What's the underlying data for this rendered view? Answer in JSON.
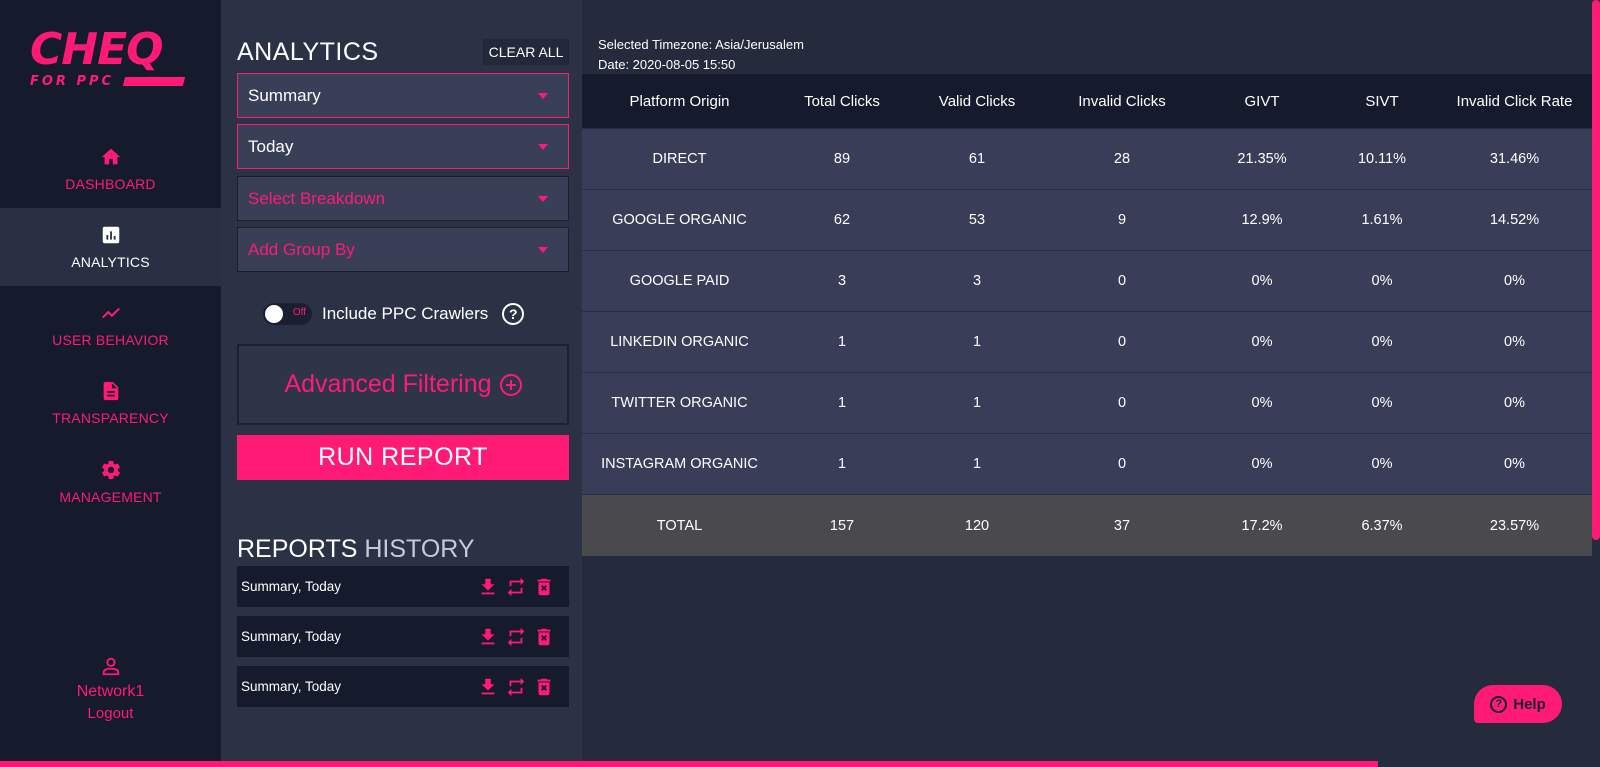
{
  "brand": {
    "logo_main": "CHEQ",
    "logo_sub": "FOR PPC",
    "accent": "#ff1a76"
  },
  "nav": {
    "items": [
      {
        "label": "DASHBOARD",
        "icon": "home-icon"
      },
      {
        "label": "ANALYTICS",
        "icon": "bar-chart-icon"
      },
      {
        "label": "USER BEHAVIOR",
        "icon": "trend-icon"
      },
      {
        "label": "TRANSPARENCY",
        "icon": "document-icon"
      },
      {
        "label": "MANAGEMENT",
        "icon": "gear-icon"
      }
    ],
    "active": "ANALYTICS",
    "user": {
      "name": "Network1",
      "logout": "Logout",
      "icon": "user-icon"
    }
  },
  "panel": {
    "title": "ANALYTICS",
    "clear_all": "CLEAR ALL",
    "report_type": "Summary",
    "date_range": "Today",
    "breakdown_placeholder": "Select Breakdown",
    "group_by_placeholder": "Add Group By",
    "toggle": {
      "state": "Off",
      "label": "Include PPC Crawlers"
    },
    "advanced_filtering": "Advanced Filtering",
    "run_report": "RUN REPORT",
    "history_title_bold": "REPORTS",
    "history_title_thin": "HISTORY",
    "history": [
      {
        "label": "Summary, Today"
      },
      {
        "label": "Summary, Today"
      },
      {
        "label": "Summary, Today"
      }
    ]
  },
  "main": {
    "timezone": "Selected Timezone: Asia/Jerusalem",
    "date": "Date: 2020-08-05 15:50",
    "columns": [
      "Platform Origin",
      "Total Clicks",
      "Valid Clicks",
      "Invalid Clicks",
      "GIVT",
      "SIVT",
      "Invalid Click Rate"
    ],
    "rows": [
      [
        "DIRECT",
        "89",
        "61",
        "28",
        "21.35%",
        "10.11%",
        "31.46%"
      ],
      [
        "GOOGLE ORGANIC",
        "62",
        "53",
        "9",
        "12.9%",
        "1.61%",
        "14.52%"
      ],
      [
        "GOOGLE PAID",
        "3",
        "3",
        "0",
        "0%",
        "0%",
        "0%"
      ],
      [
        "LINKEDIN ORGANIC",
        "1",
        "1",
        "0",
        "0%",
        "0%",
        "0%"
      ],
      [
        "TWITTER ORGANIC",
        "1",
        "1",
        "0",
        "0%",
        "0%",
        "0%"
      ],
      [
        "INSTAGRAM ORGANIC",
        "1",
        "1",
        "0",
        "0%",
        "0%",
        "0%"
      ]
    ],
    "total": [
      "TOTAL",
      "157",
      "120",
      "37",
      "17.2%",
      "6.37%",
      "23.57%"
    ],
    "help": "Help"
  }
}
